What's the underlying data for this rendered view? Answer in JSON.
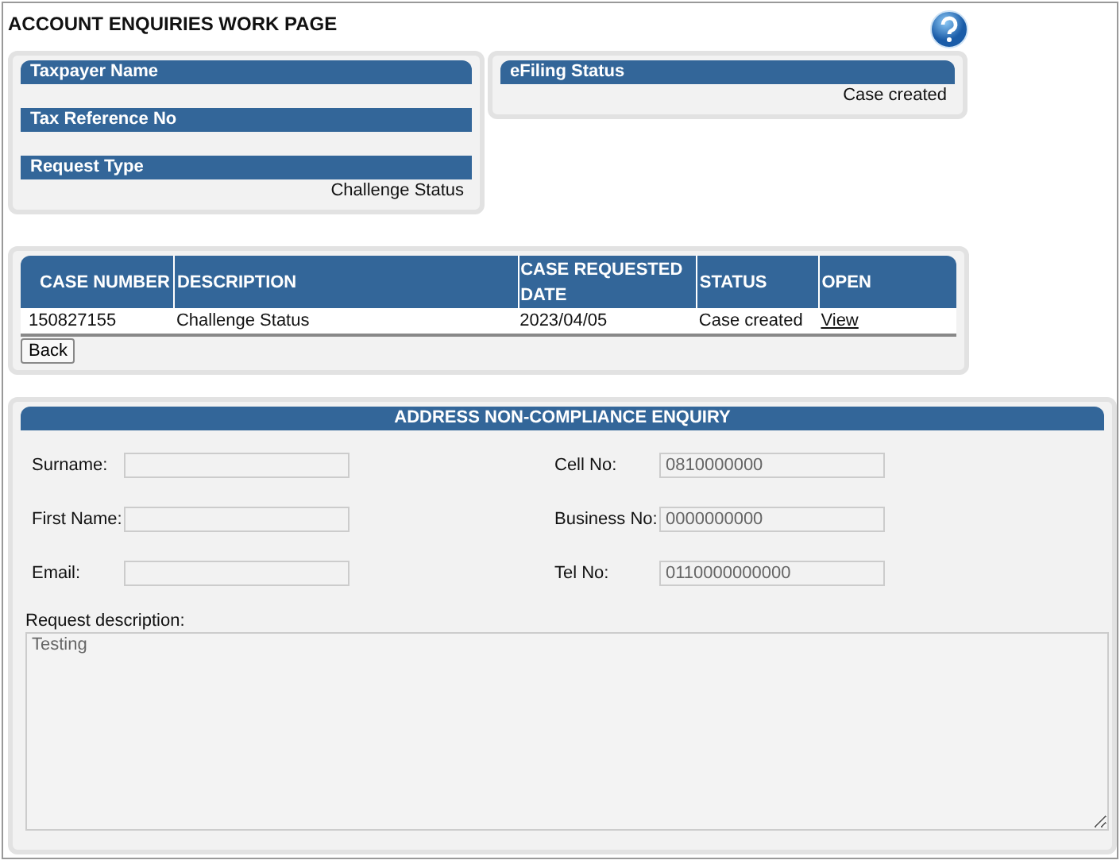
{
  "page": {
    "title": "ACCOUNT ENQUIRIES WORK PAGE"
  },
  "info_panels": [
    {
      "sections": [
        {
          "heading": "Taxpayer Name"
        },
        {
          "heading": "Tax Reference No"
        },
        {
          "heading": "Request Type",
          "value": "Challenge Status"
        }
      ]
    },
    {
      "sections": [
        {
          "heading": "eFiling Status",
          "value": "Case created"
        }
      ]
    }
  ],
  "cases": {
    "columns": [
      "CASE NUMBER",
      "DESCRIPTION",
      "CASE REQUESTED DATE",
      "STATUS",
      "OPEN"
    ],
    "rows": [
      {
        "cells": [
          "150827155",
          "Challenge Status",
          "2023/04/05",
          "Case created"
        ],
        "link": "View"
      }
    ],
    "back_button": "Back"
  },
  "enquiry": {
    "title": "ADDRESS NON-COMPLIANCE ENQUIRY",
    "fields": [
      {
        "label": "Surname:",
        "disabled": true
      },
      {
        "label": "Cell No:",
        "value": "0810000000",
        "disabled": true
      },
      {
        "label": "First Name:",
        "disabled": true
      },
      {
        "label": "Business No:",
        "value": "0000000000",
        "disabled": true
      },
      {
        "label": "Email:",
        "disabled": true
      },
      {
        "label": "Tel No:",
        "value": "0110000000000",
        "disabled": true
      }
    ],
    "description": {
      "label": "Request description:",
      "value": "Testing",
      "disabled": true
    }
  }
}
